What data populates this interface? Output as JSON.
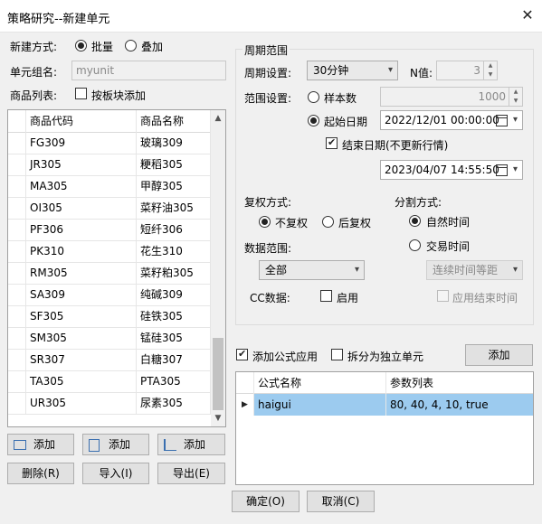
{
  "window": {
    "title": "策略研究--新建单元"
  },
  "left": {
    "create_mode_label": "新建方式:",
    "mode_batch": "批量",
    "mode_overlay": "叠加",
    "unit_group_label": "单元组名:",
    "unit_group_value": "myunit",
    "products_label": "商品列表:",
    "by_sector_label": "按板块添加",
    "table": {
      "headers": [
        "商品代码",
        "商品名称"
      ],
      "rows": [
        [
          "FG309",
          "玻璃309"
        ],
        [
          "JR305",
          "粳稻305"
        ],
        [
          "MA305",
          "甲醇305"
        ],
        [
          "OI305",
          "菜籽油305"
        ],
        [
          "PF306",
          "短纤306"
        ],
        [
          "PK310",
          "花生310"
        ],
        [
          "RM305",
          "菜籽粕305"
        ],
        [
          "SA309",
          "纯碱309"
        ],
        [
          "SF305",
          "硅铁305"
        ],
        [
          "SM305",
          "锰硅305"
        ],
        [
          "SR307",
          "白糖307"
        ],
        [
          "TA305",
          "PTA305"
        ],
        [
          "UR305",
          "尿素305"
        ]
      ]
    },
    "add_buttons": [
      "添加",
      "添加",
      "添加"
    ],
    "delete_button": "删除(R)",
    "import_button": "导入(I)",
    "export_button": "导出(E)"
  },
  "period": {
    "group_title": "周期范围",
    "period_label": "周期设置:",
    "period_value": "30分钟",
    "n_label": "N值:",
    "n_value": "3",
    "range_label": "范围设置:",
    "sample_count_label": "样本数",
    "sample_count_value": "1000",
    "start_date_label": "起始日期",
    "start_date_value": "2022/12/01 00:00:00",
    "end_date_label": "结束日期(不更新行情)",
    "end_date_value": "2023/04/07 14:55:50",
    "adjust_label": "复权方式:",
    "adjust_none": "不复权",
    "adjust_back": "后复权",
    "split_label": "分割方式:",
    "split_natural": "自然时间",
    "split_trade": "交易时间",
    "data_range_label": "数据范围:",
    "data_range_value": "全部",
    "trade_time_select": "连续时间等距",
    "cc_label": "CC数据:",
    "cc_enable": "启用",
    "apply_end_time": "应用结束时间"
  },
  "formula": {
    "add_formula_apply": "添加公式应用",
    "split_independent": "拆分为独立单元",
    "add_button": "添加",
    "headers": [
      "公式名称",
      "参数列表"
    ],
    "rows": [
      [
        "haigui",
        "80, 40, 4, 10, true"
      ]
    ]
  },
  "footer": {
    "ok": "确定(O)",
    "cancel": "取消(C)"
  }
}
